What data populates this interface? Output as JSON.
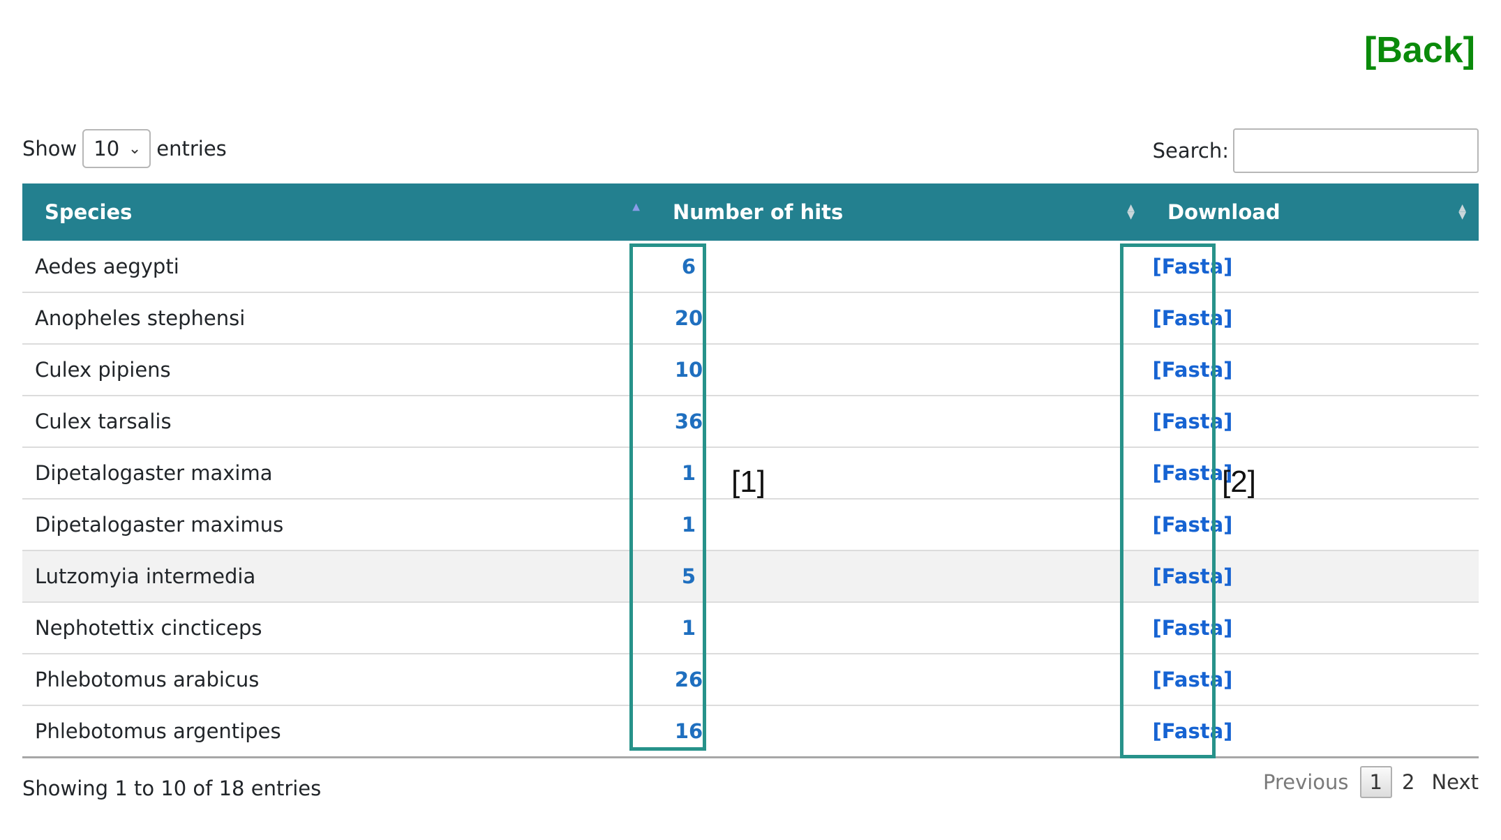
{
  "header": {
    "back_label": "[Back]"
  },
  "length_control": {
    "show_label": "Show",
    "selected": "10",
    "entries_label": "entries"
  },
  "search": {
    "label": "Search:",
    "value": "",
    "placeholder": ""
  },
  "table": {
    "columns": [
      "Species",
      "Number of hits",
      "Download"
    ],
    "rows": [
      {
        "species": "Aedes aegypti",
        "hits": "6",
        "download": "[Fasta]"
      },
      {
        "species": "Anopheles stephensi",
        "hits": "20",
        "download": "[Fasta]"
      },
      {
        "species": "Culex pipiens",
        "hits": "10",
        "download": "[Fasta]"
      },
      {
        "species": "Culex tarsalis",
        "hits": "36",
        "download": "[Fasta]"
      },
      {
        "species": "Dipetalogaster maxima",
        "hits": "1",
        "download": "[Fasta]"
      },
      {
        "species": "Dipetalogaster maximus",
        "hits": "1",
        "download": "[Fasta]"
      },
      {
        "species": "Lutzomyia intermedia",
        "hits": "5",
        "download": "[Fasta]"
      },
      {
        "species": "Nephotettix cincticeps",
        "hits": "1",
        "download": "[Fasta]"
      },
      {
        "species": "Phlebotomus arabicus",
        "hits": "26",
        "download": "[Fasta]"
      },
      {
        "species": "Phlebotomus argentipes",
        "hits": "16",
        "download": "[Fasta]"
      }
    ]
  },
  "annotations": {
    "marker_1": "[1]",
    "marker_2": "[2]"
  },
  "footer": {
    "info": "Showing 1 to 10 of 18 entries",
    "pagination": {
      "previous": "Previous",
      "pages": [
        "1",
        "2"
      ],
      "next": "Next"
    }
  },
  "colors": {
    "header_bg": "#23808f",
    "back_link": "#0a8a0a",
    "link": "#1f6fbf",
    "highlight_box": "#27928a"
  }
}
